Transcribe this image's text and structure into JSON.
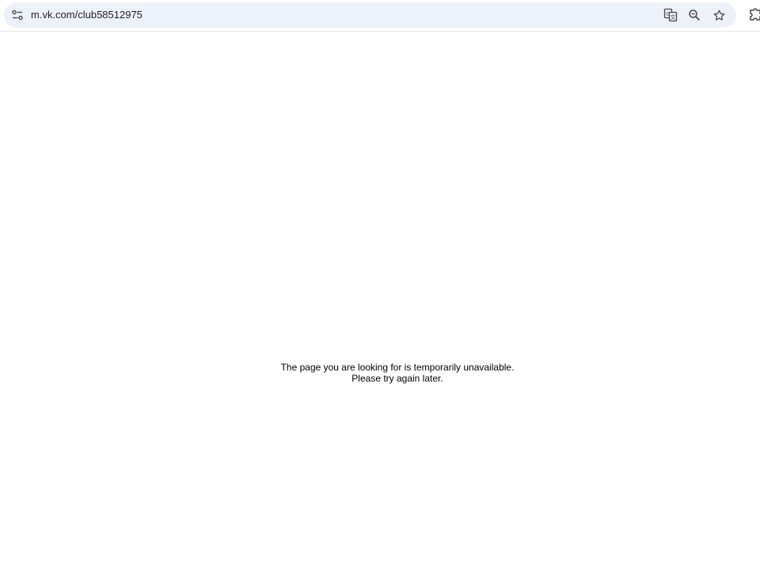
{
  "browser": {
    "url": "m.vk.com/club58512975",
    "icons": {
      "site_info": "tune-icon",
      "translate": "translate-icon",
      "zoom": "zoom-out-icon",
      "bookmark": "star-icon",
      "extensions": "puzzle-icon"
    }
  },
  "page": {
    "message_line1": "The page you are looking for is temporarily unavailable.",
    "message_line2": "Please try again later."
  },
  "colors": {
    "omnibox_background": "#edf2fa",
    "text": "#1f1f1f",
    "icon": "#474747"
  }
}
